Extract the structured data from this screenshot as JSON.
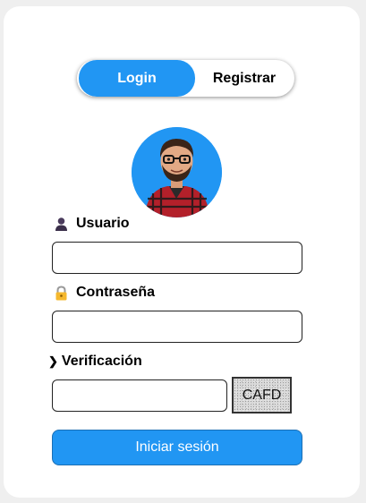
{
  "tabs": {
    "login": "Login",
    "register": "Registrar"
  },
  "form": {
    "user_label": "Usuario",
    "password_label": "Contraseña",
    "verification_label": "Verificación",
    "verification_chevron": "❯",
    "user_value": "",
    "password_value": "",
    "verification_value": "",
    "captcha_text": "CAFD",
    "submit_label": "Iniciar sesión"
  },
  "colors": {
    "accent": "#2196f3",
    "background": "#efefef",
    "card": "#ffffff"
  },
  "icons": {
    "user": "user-icon",
    "lock": "lock-icon",
    "chevron": "chevron-right-icon",
    "avatar": "avatar-image"
  }
}
